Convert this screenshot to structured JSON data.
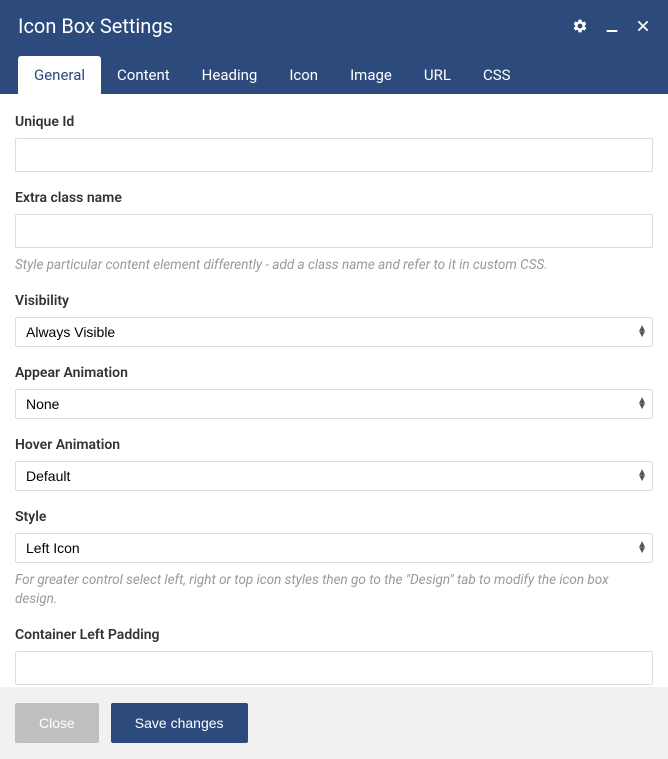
{
  "header": {
    "title": "Icon Box Settings"
  },
  "tabs": [
    {
      "label": "General",
      "active": true
    },
    {
      "label": "Content",
      "active": false
    },
    {
      "label": "Heading",
      "active": false
    },
    {
      "label": "Icon",
      "active": false
    },
    {
      "label": "Image",
      "active": false
    },
    {
      "label": "URL",
      "active": false
    },
    {
      "label": "CSS",
      "active": false
    }
  ],
  "fields": {
    "unique_id": {
      "label": "Unique Id",
      "value": ""
    },
    "extra_class": {
      "label": "Extra class name",
      "value": "",
      "help": "Style particular content element differently - add a class name and refer to it in custom CSS."
    },
    "visibility": {
      "label": "Visibility",
      "value": "Always Visible"
    },
    "appear_animation": {
      "label": "Appear Animation",
      "value": "None"
    },
    "hover_animation": {
      "label": "Hover Animation",
      "value": "Default"
    },
    "style": {
      "label": "Style",
      "value": "Left Icon",
      "help": "For greater control select left, right or top icon styles then go to the \"Design\" tab to modify the icon box design."
    },
    "container_left_padding": {
      "label": "Container Left Padding",
      "value": ""
    }
  },
  "footer": {
    "close": "Close",
    "save": "Save changes"
  }
}
